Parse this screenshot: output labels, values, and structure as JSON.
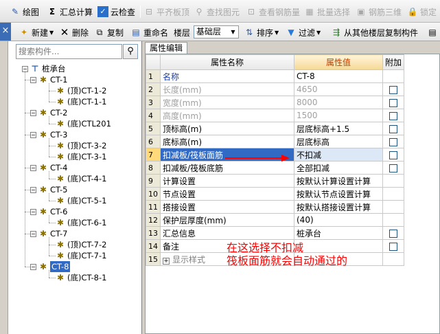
{
  "toolbar1": {
    "draw": "绘图",
    "sum": "汇总计算",
    "cloud_check": "云检查",
    "align_top": "平齐板顶",
    "find_element": "查找图元",
    "view_rebar": "查看钢筋量",
    "batch_select": "批量选择",
    "rebar_3d": "钢筋三维",
    "lock": "锁定"
  },
  "toolbar2": {
    "new": "新建",
    "delete": "删除",
    "copy": "复制",
    "rename": "重命名",
    "floor_label": "楼层",
    "floor_value": "基础层",
    "sort": "排序",
    "filter": "过滤",
    "copy_from_floor": "从其他楼层复制构件"
  },
  "search": {
    "placeholder": "搜索构件..."
  },
  "tree": {
    "root": "桩承台",
    "nodes": [
      {
        "label": "CT-1",
        "children": [
          "(顶)CT-1-2",
          "(底)CT-1-1"
        ]
      },
      {
        "label": "CT-2",
        "children": [
          "(底)CTL201"
        ]
      },
      {
        "label": "CT-3",
        "children": [
          "(顶)CT-3-2",
          "(底)CT-3-1"
        ]
      },
      {
        "label": "CT-4",
        "children": [
          "(底)CT-4-1"
        ]
      },
      {
        "label": "CT-5",
        "children": [
          "(底)CT-5-1"
        ]
      },
      {
        "label": "CT-6",
        "children": [
          "(底)CT-6-1"
        ]
      },
      {
        "label": "CT-7",
        "children": [
          "(顶)CT-7-2",
          "(底)CT-7-1"
        ]
      },
      {
        "label": "CT-8",
        "children": [
          "(底)CT-8-1"
        ]
      }
    ],
    "selected": "CT-8"
  },
  "props": {
    "tab": "属性编辑",
    "headers": {
      "name": "属性名称",
      "value": "属性值",
      "extra": "附加"
    },
    "rows": [
      {
        "n": "1",
        "name": "名称",
        "value": "CT-8",
        "style": "blue",
        "check": false
      },
      {
        "n": "2",
        "name": "长度(mm)",
        "value": "4650",
        "style": "gray",
        "check": true
      },
      {
        "n": "3",
        "name": "宽度(mm)",
        "value": "8000",
        "style": "gray",
        "check": true
      },
      {
        "n": "4",
        "name": "高度(mm)",
        "value": "1500",
        "style": "gray",
        "check": true
      },
      {
        "n": "5",
        "name": "顶标高(m)",
        "value": "层底标高+1.5",
        "style": "",
        "check": true
      },
      {
        "n": "6",
        "name": "底标高(m)",
        "value": "层底标高",
        "style": "",
        "check": true
      },
      {
        "n": "7",
        "name": "扣减板/筏板面筋",
        "value": "不扣减",
        "style": "sel",
        "check": true
      },
      {
        "n": "8",
        "name": "扣减板/筏板底筋",
        "value": "全部扣减",
        "style": "",
        "check": true
      },
      {
        "n": "9",
        "name": "计算设置",
        "value": "按默认计算设置计算",
        "style": "",
        "check": false
      },
      {
        "n": "10",
        "name": "节点设置",
        "value": "按默认节点设置计算",
        "style": "",
        "check": false
      },
      {
        "n": "11",
        "name": "搭接设置",
        "value": "按默认搭接设置计算",
        "style": "",
        "check": false
      },
      {
        "n": "12",
        "name": "保护层厚度(mm)",
        "value": "(40)",
        "style": "",
        "check": false
      },
      {
        "n": "13",
        "name": "汇总信息",
        "value": "桩承台",
        "style": "",
        "check": true
      },
      {
        "n": "14",
        "name": "备注",
        "value": "",
        "style": "",
        "check": true
      },
      {
        "n": "15",
        "name": "显示样式",
        "value": "",
        "style": "group",
        "check": false
      }
    ]
  },
  "annotation": {
    "line1": "在这选择不扣减",
    "line2": "筏板面筋就会自动通过的"
  },
  "colors": {
    "accent": "#316ac5",
    "annotation": "#ff0000",
    "header_value": "#c04000"
  }
}
